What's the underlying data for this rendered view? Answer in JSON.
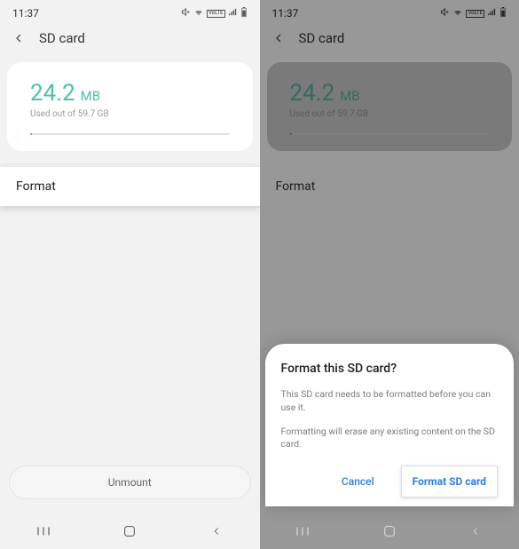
{
  "status": {
    "time": "11:37"
  },
  "header": {
    "title": "SD card"
  },
  "usage": {
    "amount": "24.2",
    "unit": "MB",
    "subtext": "Used out of 59.7 GB"
  },
  "actions": {
    "format": "Format",
    "unmount": "Unmount"
  },
  "dialog": {
    "title": "Format this SD card?",
    "line1": "This SD card needs to be formatted before you can use it.",
    "line2": "Formatting will erase any existing content on the SD card.",
    "cancel": "Cancel",
    "confirm": "Format SD card"
  }
}
